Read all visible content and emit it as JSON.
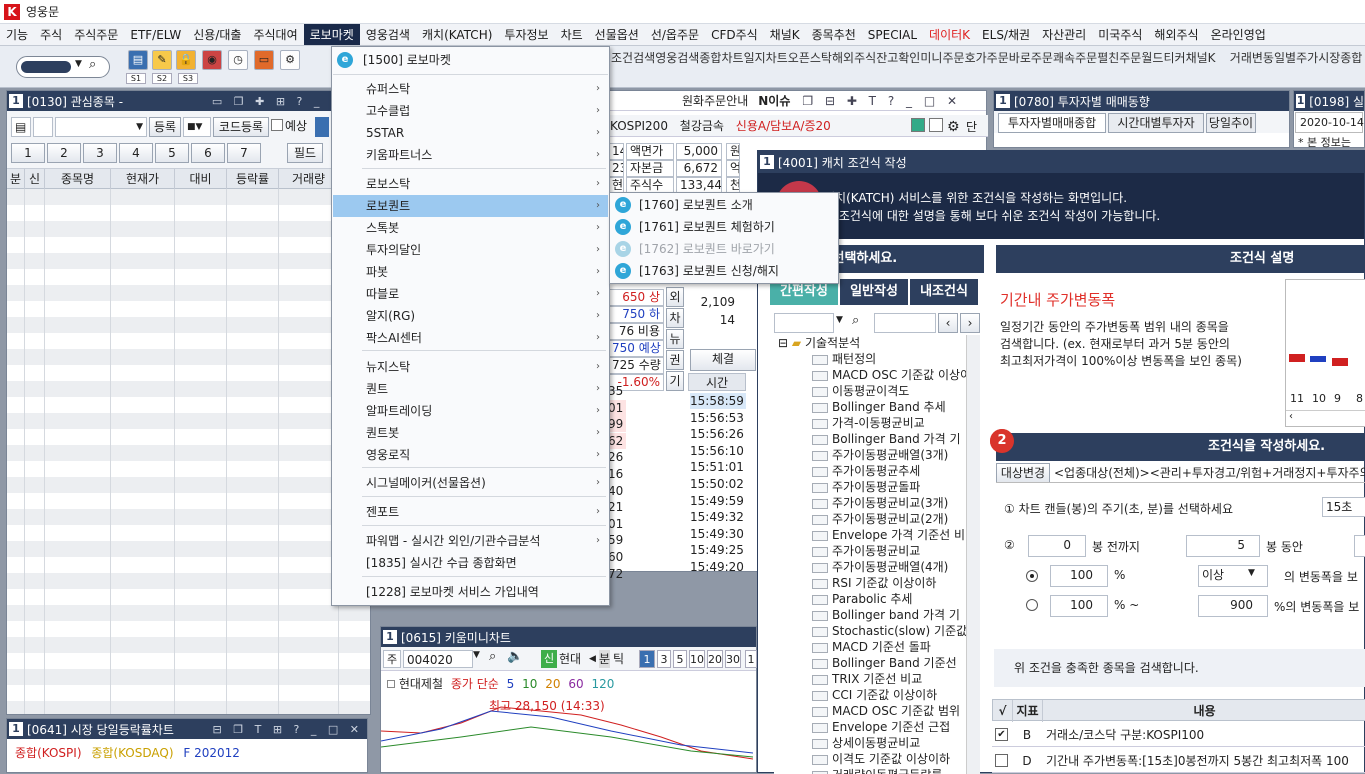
{
  "app": {
    "title": "영웅문"
  },
  "menubar": [
    "기능",
    "주식",
    "주식주문",
    "ETF/ELW",
    "신용/대출",
    "주식대여",
    "로보마켓",
    "영웅검색",
    "캐치(KATCH)",
    "투자정보",
    "차트",
    "선물옵션",
    "선/옵주문",
    "CFD주식",
    "채널K",
    "종목추천",
    "SPECIAL",
    "데이터K",
    "ELS/채권",
    "자산관리",
    "미국주식",
    "해외주식",
    "온라인영업"
  ],
  "toolbar": {
    "s1": "S1",
    "s2": "S2",
    "s3": "S3",
    "shortcuts": [
      "조건검색",
      "영웅검색",
      "종합차트",
      "일지차트",
      "오픈스탁",
      "해외주식",
      "잔고확인",
      "미니주문",
      "호가주문",
      "바로주문",
      "쾌속주문",
      "펼친주문",
      "월드티커",
      "채널K",
      "거래변동",
      "일별주가",
      "시장종합",
      "시세"
    ]
  },
  "watchlist": {
    "title": "[0130] 관심종목 -",
    "register": "등록",
    "code_register": "코드등록",
    "reserve": "예상",
    "tabs": [
      "1",
      "2",
      "3",
      "4",
      "5",
      "6",
      "7"
    ],
    "field": "필드",
    "columns": [
      "분",
      "신",
      "종목명",
      "현재가",
      "대비",
      "등락률",
      "거래량"
    ]
  },
  "market_chart": {
    "title": "[0641] 시장 당일등락률차트",
    "legend": [
      "종합(KOSPI)",
      "종합(KOSDAQ)",
      "F 202012"
    ]
  },
  "order_window": {
    "title": "원화주문안내",
    "issue": "N이슈",
    "market": "KOSPI200",
    "metal": "철강금속",
    "credit": "신용A/담보A/증20",
    "rows": [
      [
        "14",
        "액면가",
        "5,000",
        "원"
      ],
      [
        "23",
        "자본금",
        "6,672",
        "억"
      ],
      [
        "현)",
        "주식수",
        "133,446",
        "천"
      ]
    ],
    "quotes": [
      "650 상",
      "750 하",
      "76 비용",
      "750 예상",
      "725 수량",
      "-1.60%"
    ],
    "side": [
      "외",
      "차",
      "뉴",
      "권",
      "기"
    ],
    "exec_label": "체결",
    "time_label": "시간",
    "times": [
      "15:58:59",
      "15:56:53",
      "15:56:26",
      "15:56:10",
      "15:51:01",
      "15:50:02",
      "15:49:59",
      "15:49:32",
      "15:49:30",
      "15:49:25",
      "15:49:20"
    ],
    "left_nums": [
      "35",
      "01",
      "99",
      "62",
      "26",
      "16",
      "40",
      "21",
      "01",
      "59",
      "60",
      "72"
    ],
    "qty": [
      "2,109",
      "14"
    ],
    "extra": [
      "14"
    ]
  },
  "mini_chart": {
    "title": "[0615] 키움미니차트",
    "code": "004020",
    "name": "현대제철",
    "period": "분",
    "tick": "틱",
    "nums": [
      "1",
      "3",
      "5",
      "10",
      "20",
      "30",
      "1"
    ],
    "legend": [
      "현대제철",
      "종가 단순",
      "5",
      "10",
      "20",
      "60",
      "120"
    ],
    "high_label": "최고 28,150 (14:33)",
    "prefix": "주",
    "sin": "신",
    "hyundae": "현대"
  },
  "investor_window": {
    "title": "[0780] 투자자별 매매동향",
    "tabs": [
      "투자자별매매종합",
      "시간대별투자자",
      "당일추이"
    ]
  },
  "side_window": {
    "title": "[0198] 실",
    "date": "2020-10-14",
    "info": "* 본 정보는"
  },
  "katch": {
    "title": "[4001] 캐치 조건식 작성",
    "banner1": "캐치(KATCH) 서비스를 위한 조건식을 작성하는 화면입니다.",
    "banner2": "각 조건식에 대한 설명을 통해 보다 쉬운 조건식 작성이 가능합니다.",
    "select_header": "을 선택하세요.",
    "tabs": [
      "간편작성",
      "일반작성",
      "내조건식"
    ],
    "tree_root": "기술적분석",
    "tree_items": [
      "패턴정의",
      "MACD OSC 기준값 이상이",
      "이동평균이격도",
      "Bollinger Band 추세",
      "가격-이동평균비교",
      "Bollinger Band 가격 기",
      "주가이동평균배열(3개)",
      "주가이동평균추세",
      "주가이동평균돌파",
      "주가이동평균비교(3개)",
      "주가이동평균비교(2개)",
      "Envelope 가격 기준선 비",
      "주가이동평균비교",
      "주가이동평균배열(4개)",
      "RSI 기준값 이상이하",
      "Parabolic 추세",
      "Bollinger band 가격 기",
      "Stochastic(slow) 기준값",
      "MACD 기준선 돌파",
      "Bollinger Band 기준선",
      "TRIX 기준선 비교",
      "CCI 기준값 이상이하",
      "MACD OSC 기준값 범위",
      "Envelope 기준선 근접",
      "상세이동평균비교",
      "이격도 기준값 이상이하",
      "거래량이동평균등락률"
    ],
    "desc_header": "조건식 설명",
    "desc_title": "기간내 주가변동폭",
    "desc_text1": "일정기간 동안의 주가변동폭 범위 내의 종목을",
    "desc_text2": "검색합니다. (ex. 현재로부터 과거 5분 동안의",
    "desc_text3": "최고최저가격이 100%이상 변동폭을 보인 종목)",
    "chart_ticks": [
      "11",
      "10",
      "9",
      "8"
    ],
    "step2": "2",
    "write_header": "조건식을 작성하세요.",
    "target_btn": "대상변경",
    "target_text": "<업종대상(전체)><관리+투자경고/위험+거래정지+투자주의",
    "q1": "① 차트 캔들(봉)의 주기(초, 분)를 선택하세요",
    "q1_val": "15초",
    "q2": "②",
    "bong_before": "봉 전까지",
    "bong_during": "봉 동안",
    "val0": "0",
    "val5": "5",
    "val100a": "100",
    "pct": "%",
    "above": "이상",
    "q_change1": "의 변동폭을 보",
    "val100b": "100",
    "pct_range": "% ~",
    "val900": "900",
    "q_change2": "%의 변동폭을 보",
    "search_text": "위 조건을 충족한 종목을 검색합니다.",
    "table_head": [
      "√",
      "지표",
      "내용"
    ],
    "rows": [
      {
        "chk": "✔",
        "key": "B",
        "content": "거래소/코스닥 구분:KOSPI100"
      },
      {
        "chk": "",
        "key": "D",
        "content": "기간내 주가변동폭:[15초]0봉전까지 5봉간 최고최저폭 100"
      }
    ]
  },
  "robo_menu": {
    "header": "[1500] 로보마켓",
    "items": [
      "슈퍼스탁",
      "고수클럽",
      "5STAR",
      "키움파트너스",
      "로보스탁",
      "로보퀀트",
      "스톡봇",
      "투자의달인",
      "파봇",
      "따블로",
      "알지(RG)",
      "팍스AI센터",
      "뉴지스탁",
      "퀀트",
      "알파트레이딩",
      "퀀트봇",
      "영웅로직",
      "시그널메이커(선물옵션)",
      "젠포트",
      "파워맵 - 실시간 외인/기관수급분석",
      "[1835] 실시간 수급 종합화면",
      "[1228] 로보마켓 서비스 가입내역"
    ]
  },
  "robo_sub": {
    "items": [
      "[1760] 로보퀀트 소개",
      "[1761] 로보퀀트 체험하기",
      "[1762] 로보퀀트 바로가기",
      "[1763] 로보퀀트 신청/해지"
    ]
  }
}
